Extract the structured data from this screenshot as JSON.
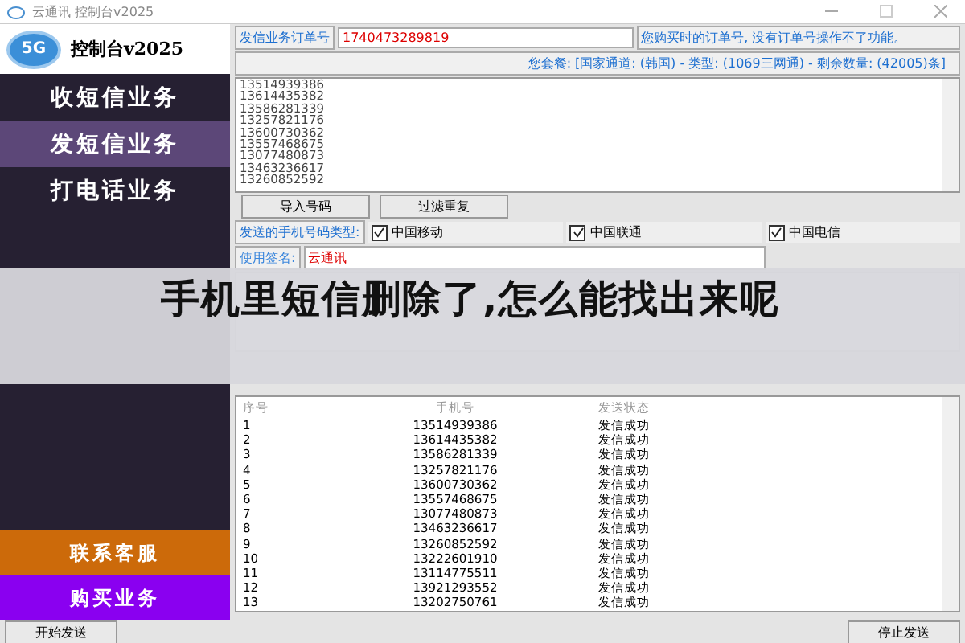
{
  "window": {
    "title": "云通讯 控制台v2025"
  },
  "logo": {
    "badge": "5G",
    "title": "控制台v2025"
  },
  "sidebar": {
    "items": [
      {
        "label": "收短信业务",
        "selected": false
      },
      {
        "label": "发短信业务",
        "selected": true
      },
      {
        "label": "打电话业务",
        "selected": false
      }
    ],
    "bottom_items": [
      {
        "label": "联系客服",
        "color": "#cc6a0a"
      },
      {
        "label": "购买业务",
        "color": "#8a00f0"
      }
    ]
  },
  "order": {
    "label": "发信业务订单号",
    "value": "1740473289819",
    "hint": "您购买时的订单号, 没有订单号操作不了功能。"
  },
  "package": "您套餐: [国家通道: (韩国) - 类型: (1069三网通) - 剩余数量: (42005)条]",
  "numbers": [
    "13514939386",
    "13614435382",
    "13586281339",
    "13257821176",
    "13600730362",
    "13557468675",
    "13077480873",
    "13463236617",
    "13260852592"
  ],
  "buttons": [
    "导入号码",
    "过滤重复"
  ],
  "carriers": {
    "label": "发送的手机号码类型:",
    "items": [
      {
        "label": "中国移动",
        "checked": true
      },
      {
        "label": "中国联通",
        "checked": true
      },
      {
        "label": "中国电信",
        "checked": true
      }
    ]
  },
  "signature": {
    "label": "使用签名:",
    "value": "云通讯"
  },
  "table": {
    "columns": [
      "序号",
      "手机号",
      "发送状态"
    ],
    "rows": [
      [
        "1",
        "13514939386",
        "发信成功"
      ],
      [
        "2",
        "13614435382",
        "发信成功"
      ],
      [
        "3",
        "13586281339",
        "发信成功"
      ],
      [
        "4",
        "13257821176",
        "发信成功"
      ],
      [
        "5",
        "13600730362",
        "发信成功"
      ],
      [
        "6",
        "13557468675",
        "发信成功"
      ],
      [
        "7",
        "13077480873",
        "发信成功"
      ],
      [
        "8",
        "13463236617",
        "发信成功"
      ],
      [
        "9",
        "13260852592",
        "发信成功"
      ],
      [
        "10",
        "13222601910",
        "发信成功"
      ],
      [
        "11",
        "13114775511",
        "发信成功"
      ],
      [
        "12",
        "13921293552",
        "发信成功"
      ],
      [
        "13",
        "13202750761",
        "发信成功"
      ]
    ]
  },
  "actions": [
    "开始发送",
    "停止发送"
  ],
  "overlay_title": "手机里短信删除了,怎么能找出来呢"
}
